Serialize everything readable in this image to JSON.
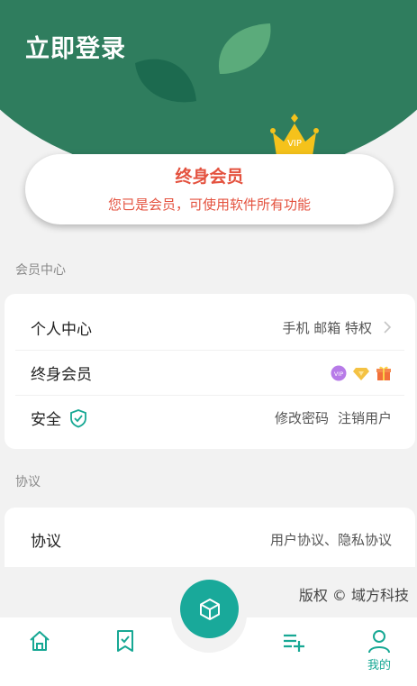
{
  "header": {
    "login_label": "立即登录"
  },
  "vip_card": {
    "title": "终身会员",
    "subtitle": "您已是会员，可使用软件所有功能",
    "badge_text": "VIP"
  },
  "member_center": {
    "section_label": "会员中心",
    "rows": [
      {
        "label": "个人中心",
        "right": "手机 邮箱 特权"
      },
      {
        "label": "终身会员",
        "badge_text": "VIP"
      },
      {
        "label": "安全",
        "links": [
          "修改密码",
          "注销用户"
        ]
      }
    ]
  },
  "agreement": {
    "section_label": "协议",
    "rows": [
      {
        "label": "协议",
        "right": "用户协议、隐私协议"
      }
    ]
  },
  "copyright": "版权 © 域方科技",
  "tabbar": {
    "active_label": "我的",
    "icons": [
      "home-icon",
      "bookmark-icon",
      "cube-icon",
      "playlist-add-icon",
      "user-icon"
    ]
  },
  "colors": {
    "header_green": "#2f7d5e",
    "accent_teal": "#17a894",
    "vip_red": "#e4523f"
  }
}
